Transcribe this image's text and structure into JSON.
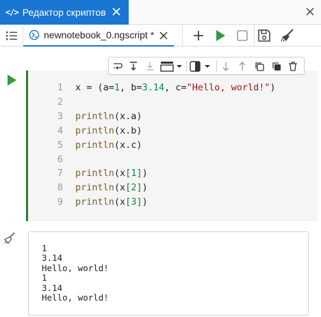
{
  "panel_tab": {
    "title": "Редактор скриптов"
  },
  "doc_tab": {
    "name": "newnotebook_0.ngscript",
    "modified": "*"
  },
  "toolbar": {
    "actions": [
      "add-cell",
      "run",
      "stop",
      "save",
      "clear"
    ]
  },
  "cell": {
    "lines": [
      {
        "n": "1",
        "tokens": [
          [
            "var",
            "x = ("
          ],
          [
            "var",
            "a="
          ],
          [
            "num",
            "1"
          ],
          [
            "var",
            ", b="
          ],
          [
            "num",
            "3.14"
          ],
          [
            "var",
            ", c="
          ],
          [
            "str",
            "\"Hello, world!\""
          ],
          [
            "var",
            ")"
          ]
        ]
      },
      {
        "n": "2",
        "tokens": []
      },
      {
        "n": "3",
        "tokens": [
          [
            "fn",
            "println"
          ],
          [
            "var",
            "(x.a)"
          ]
        ]
      },
      {
        "n": "4",
        "tokens": [
          [
            "fn",
            "println"
          ],
          [
            "var",
            "(x.b)"
          ]
        ]
      },
      {
        "n": "5",
        "tokens": [
          [
            "fn",
            "println"
          ],
          [
            "var",
            "(x.c)"
          ]
        ]
      },
      {
        "n": "6",
        "tokens": []
      },
      {
        "n": "7",
        "tokens": [
          [
            "fn",
            "println"
          ],
          [
            "var",
            "(x"
          ],
          [
            "br",
            "["
          ],
          [
            "num",
            "1"
          ],
          [
            "br",
            "]"
          ],
          [
            "var",
            ")"
          ]
        ]
      },
      {
        "n": "8",
        "tokens": [
          [
            "fn",
            "println"
          ],
          [
            "var",
            "(x"
          ],
          [
            "br",
            "["
          ],
          [
            "num",
            "2"
          ],
          [
            "br",
            "]"
          ],
          [
            "var",
            ")"
          ]
        ]
      },
      {
        "n": "9",
        "tokens": [
          [
            "fn",
            "println"
          ],
          [
            "var",
            "(x"
          ],
          [
            "br",
            "["
          ],
          [
            "num",
            "3"
          ],
          [
            "br",
            "]"
          ],
          [
            "var",
            ")"
          ]
        ]
      }
    ]
  },
  "output": {
    "lines": [
      "1",
      "3.14",
      "Hello, world!",
      "1",
      "3.14",
      "Hello, world!"
    ]
  },
  "colors": {
    "accent": "#1976d2",
    "run_green": "#2e9d3b",
    "cell_border": "#2e7d32"
  }
}
